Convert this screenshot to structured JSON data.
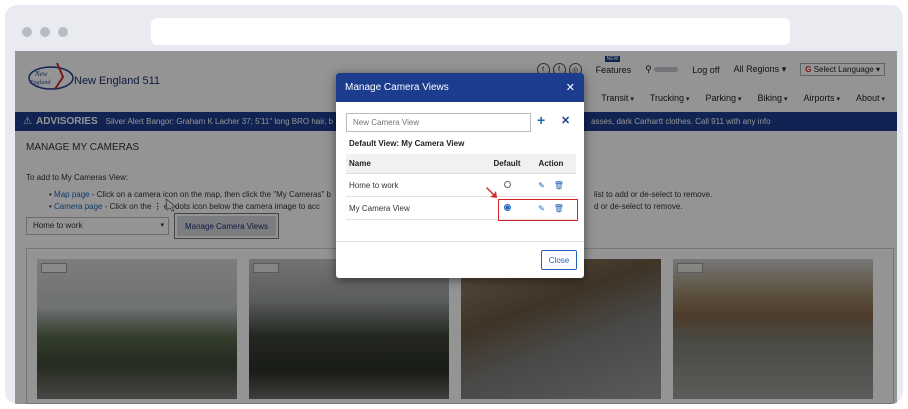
{
  "site": {
    "name": "New England 511",
    "logo_text": "New England Compass"
  },
  "topnav": {
    "social": [
      "twitter-icon",
      "facebook-icon",
      "instagram-icon"
    ],
    "features_badge": "NEW",
    "features": "Features",
    "logoff": "Log off",
    "regions": "All Regions",
    "language": "Select Language"
  },
  "subnav": [
    "Transit",
    "Trucking",
    "Parking",
    "Biking",
    "Airports",
    "About"
  ],
  "advisory": {
    "title": "ADVISORIES",
    "text": "Silver Alert Bangor: Graham K Lacher 37; 5'11\" long BRO hair, b",
    "text_tail": "asses, dark Carhartt clothes. Call 911 with any info"
  },
  "page": {
    "title": "MANAGE MY CAMERAS",
    "instruction": "To add to My Cameras View:",
    "bullet1_link": "Map page",
    "bullet1_text": " - Click on a camera icon on the map, then click the \"My Cameras\" b",
    "bullet1_tail": "list to add or de-select to remove.",
    "bullet2_link": "Camera page",
    "bullet2_text": " - Click on the ",
    "bullet2_mid": "ee dots icon below the camera image to acc",
    "bullet2_tail": "d or de-select to remove.",
    "selected_view": "Home to work",
    "manage_button": "Manage Camera Views"
  },
  "modal": {
    "title": "Manage Camera Views",
    "input_placeholder": "New Camera View",
    "default_view_label": "Default View: My Camera View",
    "columns": {
      "name": "Name",
      "default": "Default",
      "action": "Action"
    },
    "rows": [
      {
        "name": "Home to work",
        "default": false
      },
      {
        "name": "My Camera View",
        "default": true
      }
    ],
    "close_button": "Close"
  },
  "colors": {
    "brand_blue": "#1c3d8e",
    "link_blue": "#1f63b8",
    "highlight_red": "#d42828"
  }
}
